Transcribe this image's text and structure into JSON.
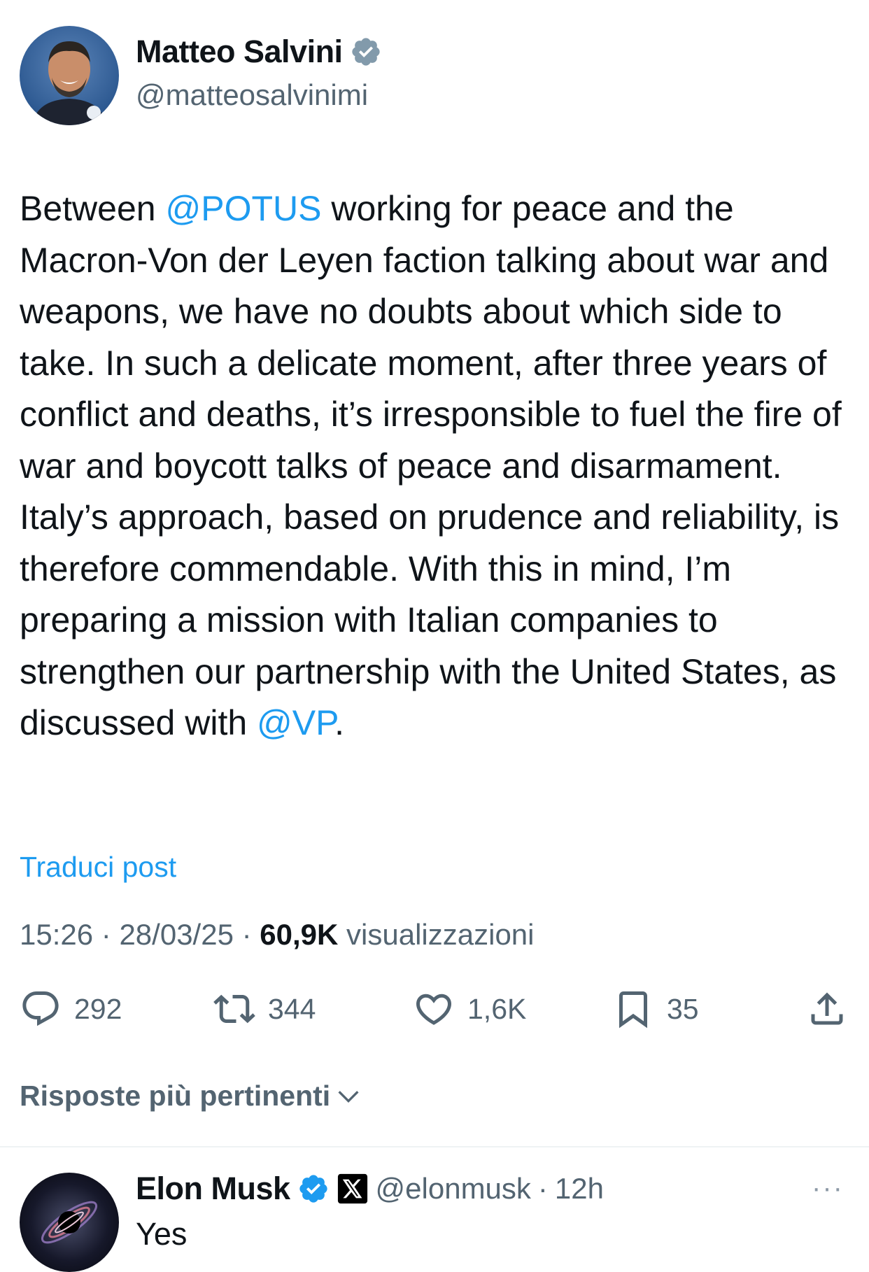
{
  "author": {
    "name": "Matteo Salvini",
    "handle": "@matteosalvinimi",
    "verified_color": "#829aab"
  },
  "tweet": {
    "segments": [
      {
        "text": "Between ",
        "type": "text"
      },
      {
        "text": "@POTUS",
        "type": "mention"
      },
      {
        "text": " working for peace and the Macron-Von der Leyen faction talking about war and weapons, we have no doubts about which side to take. In such a delicate moment, after three years of conflict and deaths, it’s irresponsible to fuel the fire of war and boycott talks of peace and disarmament. Italy’s approach, based on prudence and reliability, is therefore commendable. With this in mind, I’m preparing a mission with Italian companies to strengthen our partnership with the United States, as discussed with ",
        "type": "text"
      },
      {
        "text": "@VP",
        "type": "mention"
      },
      {
        "text": ".",
        "type": "text"
      }
    ],
    "translate_label": "Traduci post",
    "time": "15:26",
    "date": "28/03/25",
    "separator": "·",
    "views_count": "60,9K",
    "views_label": "visualizzazioni"
  },
  "actions": {
    "replies": "292",
    "reposts": "344",
    "likes": "1,6K",
    "bookmarks": "35"
  },
  "replies_sort_label": "Risposte più pertinenti",
  "reply": {
    "name": "Elon Musk",
    "handle": "@elonmusk",
    "separator": "·",
    "age": "12h",
    "text": "Yes",
    "more_label": "···",
    "verified_color": "#1d9bf0"
  },
  "colors": {
    "accent": "#1d9bf0",
    "muted": "#536471",
    "text": "#0f1419"
  }
}
